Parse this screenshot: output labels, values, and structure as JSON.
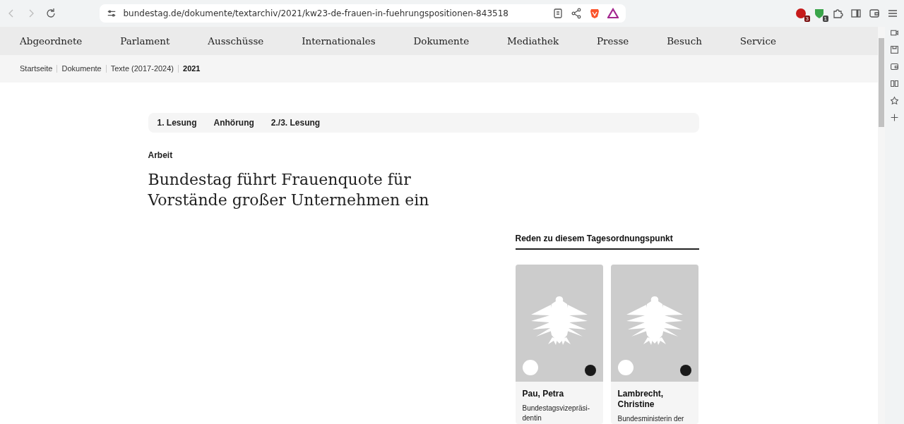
{
  "browser": {
    "url": "bundestag.de/dokumente/textarchiv/2021/kw23-de-frauen-in-fuehrungspositionen-843518",
    "extension_badges": [
      "3",
      "1"
    ]
  },
  "nav": [
    "Abgeordnete",
    "Parlament",
    "Ausschüsse",
    "Internationales",
    "Dokumente",
    "Mediathek",
    "Presse",
    "Besuch",
    "Service"
  ],
  "breadcrumb": [
    {
      "label": "Startseite",
      "current": false
    },
    {
      "label": "Dokumente",
      "current": false
    },
    {
      "label": "Texte (2017-2024)",
      "current": false
    },
    {
      "label": "2021",
      "current": true
    }
  ],
  "tabs": [
    "1. Lesung",
    "Anhörung",
    "2./3. Lesung"
  ],
  "article": {
    "category": "Arbeit",
    "title": "Bundestag führt Frauenquote für Vorstände großer Unternehmen ein"
  },
  "speeches": {
    "heading": "Reden zu diesem Tagesordnungspunkt",
    "speakers": [
      {
        "name": "Pau, Petra",
        "role": "Bundestagsvizepräsi-dentin"
      },
      {
        "name": "Lambrecht, Christine",
        "role": "Bundesministerin der"
      }
    ]
  }
}
